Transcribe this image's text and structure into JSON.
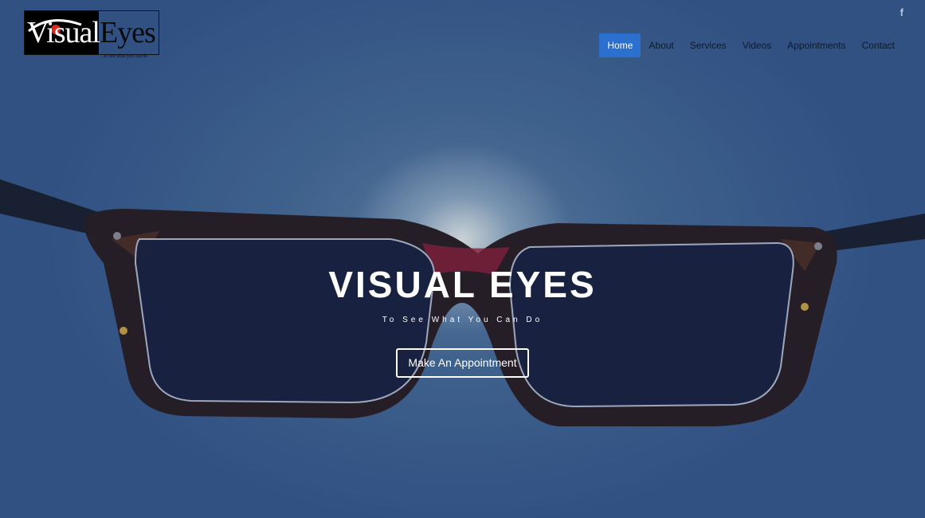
{
  "logo": {
    "word_part1": "Visual",
    "word_part2": "Eyes",
    "tagline": "...to see what you can do"
  },
  "social": {
    "facebook_glyph": "f",
    "facebook_icon": "facebook-icon"
  },
  "nav": {
    "items": [
      {
        "label": "Home",
        "active": true
      },
      {
        "label": "About"
      },
      {
        "label": "Services"
      },
      {
        "label": "Videos"
      },
      {
        "label": "Appointments"
      },
      {
        "label": "Contact"
      }
    ]
  },
  "hero": {
    "title": "VISUAL EYES",
    "subtitle": "To See What You Can Do",
    "cta_label": "Make An Appointment"
  },
  "colors": {
    "accent": "#2b6fcf",
    "background": "#3b5a86"
  }
}
